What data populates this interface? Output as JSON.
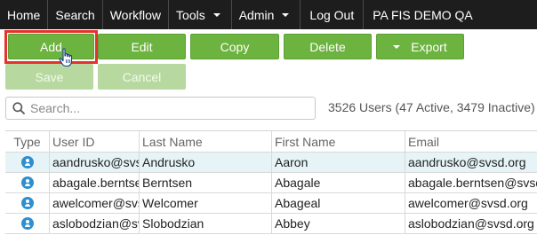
{
  "nav": {
    "items": [
      {
        "label": "Home",
        "dropdown": false
      },
      {
        "label": "Search",
        "dropdown": false
      },
      {
        "label": "Workflow",
        "dropdown": false
      },
      {
        "label": "Tools",
        "dropdown": true
      },
      {
        "label": "Admin",
        "dropdown": true
      },
      {
        "label": "Log Out",
        "dropdown": false
      }
    ],
    "title": "PA FIS DEMO QA"
  },
  "toolbar": {
    "add_label": "Add",
    "edit_label": "Edit",
    "copy_label": "Copy",
    "delete_label": "Delete",
    "export_label": "Export",
    "save_label": "Save",
    "cancel_label": "Cancel"
  },
  "search": {
    "placeholder": "Search...",
    "value": ""
  },
  "summary": "3526 Users (47 Active, 3479 Inactive)",
  "table": {
    "columns": [
      "Type",
      "User ID",
      "Last Name",
      "First Name",
      "Email"
    ],
    "rows": [
      {
        "type_icon": "user-icon",
        "user_id": "aandrusko@svsd.org",
        "last_name": "Andrusko",
        "first_name": "Aaron",
        "email": "aandrusko@svsd.org"
      },
      {
        "type_icon": "user-icon",
        "user_id": "abagale.berntsen",
        "last_name": "Berntsen",
        "first_name": "Abagale",
        "email": "abagale.berntsen@svsd.org"
      },
      {
        "type_icon": "user-icon",
        "user_id": "awelcomer@svsd.org",
        "last_name": "Welcomer",
        "first_name": "Abageal",
        "email": "awelcomer@svsd.org"
      },
      {
        "type_icon": "user-icon",
        "user_id": "aslobodzian@svsd.org",
        "last_name": "Slobodzian",
        "first_name": "Abbey",
        "email": "aslobodzian@svsd.org"
      }
    ]
  },
  "colors": {
    "nav_bg": "#1d1d1d",
    "button_green": "#6cb33f",
    "button_disabled": "#b7d99f",
    "highlight_red": "#e5322d",
    "selected_row": "#e6f4f7",
    "user_icon": "#2f8fce"
  }
}
